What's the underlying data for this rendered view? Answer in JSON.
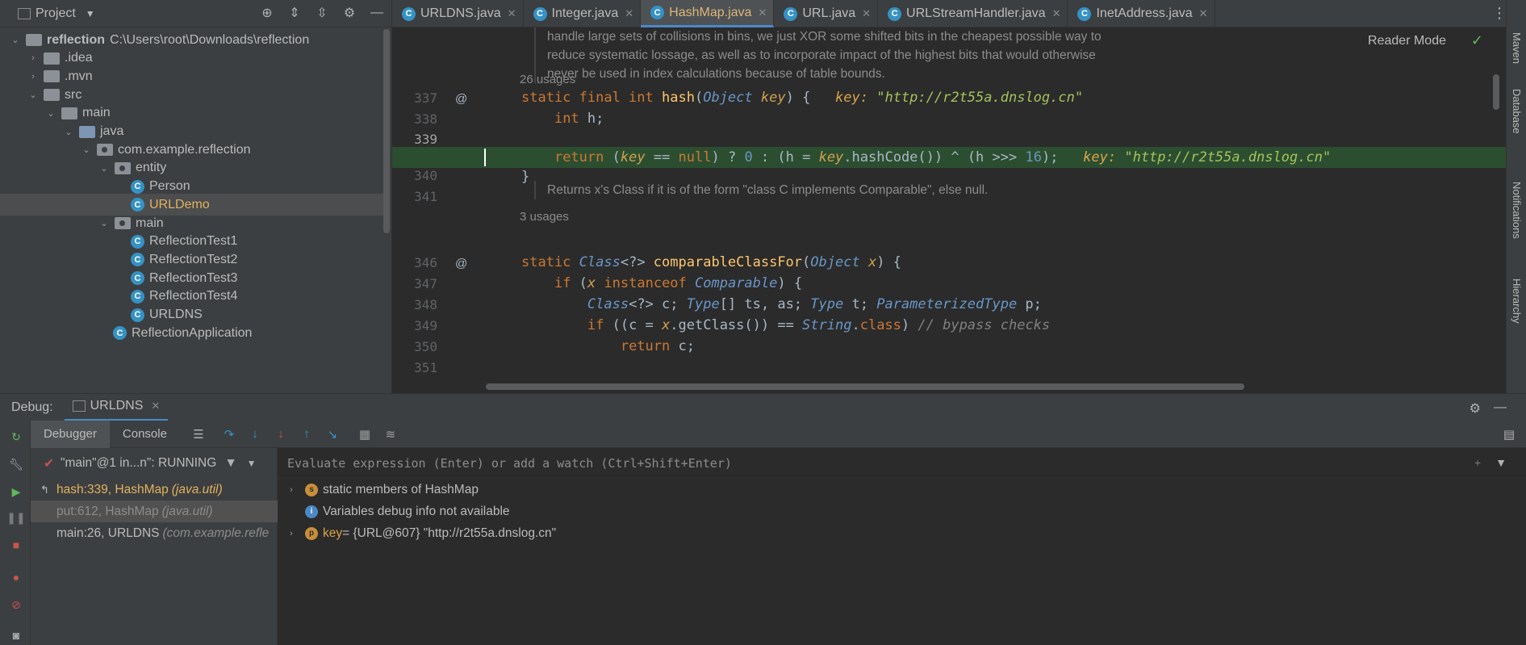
{
  "project": {
    "title": "Project",
    "tree": [
      {
        "label": "reflection",
        "hint": "C:\\Users\\root\\Downloads\\reflection",
        "depth": 0,
        "kind": "folder",
        "open": true
      },
      {
        "label": ".idea",
        "depth": 1,
        "kind": "folder",
        "open": false
      },
      {
        "label": ".mvn",
        "depth": 1,
        "kind": "folder",
        "open": false
      },
      {
        "label": "src",
        "depth": 1,
        "kind": "folder",
        "open": true
      },
      {
        "label": "main",
        "depth": 2,
        "kind": "folder",
        "open": true
      },
      {
        "label": "java",
        "depth": 3,
        "kind": "src",
        "open": true
      },
      {
        "label": "com.example.reflection",
        "depth": 4,
        "kind": "pkg",
        "open": true
      },
      {
        "label": "entity",
        "depth": 5,
        "kind": "pkg",
        "open": true
      },
      {
        "label": "Person",
        "depth": 6,
        "kind": "class"
      },
      {
        "label": "URLDemo",
        "depth": 6,
        "kind": "class",
        "selected": true
      },
      {
        "label": "main",
        "depth": 5,
        "kind": "pkg",
        "open": true
      },
      {
        "label": "ReflectionTest1",
        "depth": 6,
        "kind": "class"
      },
      {
        "label": "ReflectionTest2",
        "depth": 6,
        "kind": "class"
      },
      {
        "label": "ReflectionTest3",
        "depth": 6,
        "kind": "class"
      },
      {
        "label": "ReflectionTest4",
        "depth": 6,
        "kind": "class"
      },
      {
        "label": "URLDNS",
        "depth": 6,
        "kind": "class"
      },
      {
        "label": "ReflectionApplication",
        "depth": 5,
        "kind": "class"
      }
    ]
  },
  "tabs": [
    {
      "label": "URLDNS.java",
      "active": false
    },
    {
      "label": "Integer.java",
      "active": false
    },
    {
      "label": "HashMap.java",
      "active": true
    },
    {
      "label": "URL.java",
      "active": false
    },
    {
      "label": "URLStreamHandler.java",
      "active": false
    },
    {
      "label": "InetAddress.java",
      "active": false
    }
  ],
  "editor": {
    "reader_mode": "Reader Mode",
    "doc1": [
      "handle large sets of collisions in bins, we just XOR some shifted bits in the cheapest possible way to",
      "reduce systematic lossage, as well as to incorporate impact of the highest bits that would otherwise",
      "never be used in index calculations because of table bounds."
    ],
    "usages1": "26 usages",
    "doc2": "Returns x's Class if it is of the form \"class C implements Comparable\", else null.",
    "usages2": "3 usages",
    "line_numbers": [
      "337",
      "338",
      "339",
      "340",
      "341",
      "346",
      "347",
      "348",
      "349",
      "350",
      "351"
    ],
    "inline_hint_label": "key:",
    "inline_hint_value": "\"http://r2t55a.dnslog.cn\""
  },
  "right_strip": [
    "Maven",
    "Database",
    "Notifications",
    "Hierarchy"
  ],
  "debug": {
    "title": "Debug:",
    "session": "URLDNS",
    "tabs": [
      "Debugger",
      "Console"
    ],
    "thread": "\"main\"@1 in...n\": RUNNING",
    "frames": [
      {
        "method": "hash:339, HashMap",
        "pkg": "(java.util)",
        "state": "current"
      },
      {
        "method": "put:612, HashMap",
        "pkg": "(java.util)",
        "state": "hl"
      },
      {
        "method": "main:26, URLDNS",
        "pkg": "(com.example.refle",
        "state": "normal"
      }
    ],
    "watch_placeholder": "Evaluate expression (Enter) or add a watch (Ctrl+Shift+Enter)",
    "vars": [
      {
        "badge": "s",
        "text": "static members of HashMap",
        "expandable": true
      },
      {
        "badge": "i",
        "text": "Variables debug info not available",
        "expandable": false
      },
      {
        "badge": "p",
        "name": "key",
        "value": " = {URL@607} \"http://r2t55a.dnslog.cn\"",
        "expandable": true
      }
    ]
  }
}
